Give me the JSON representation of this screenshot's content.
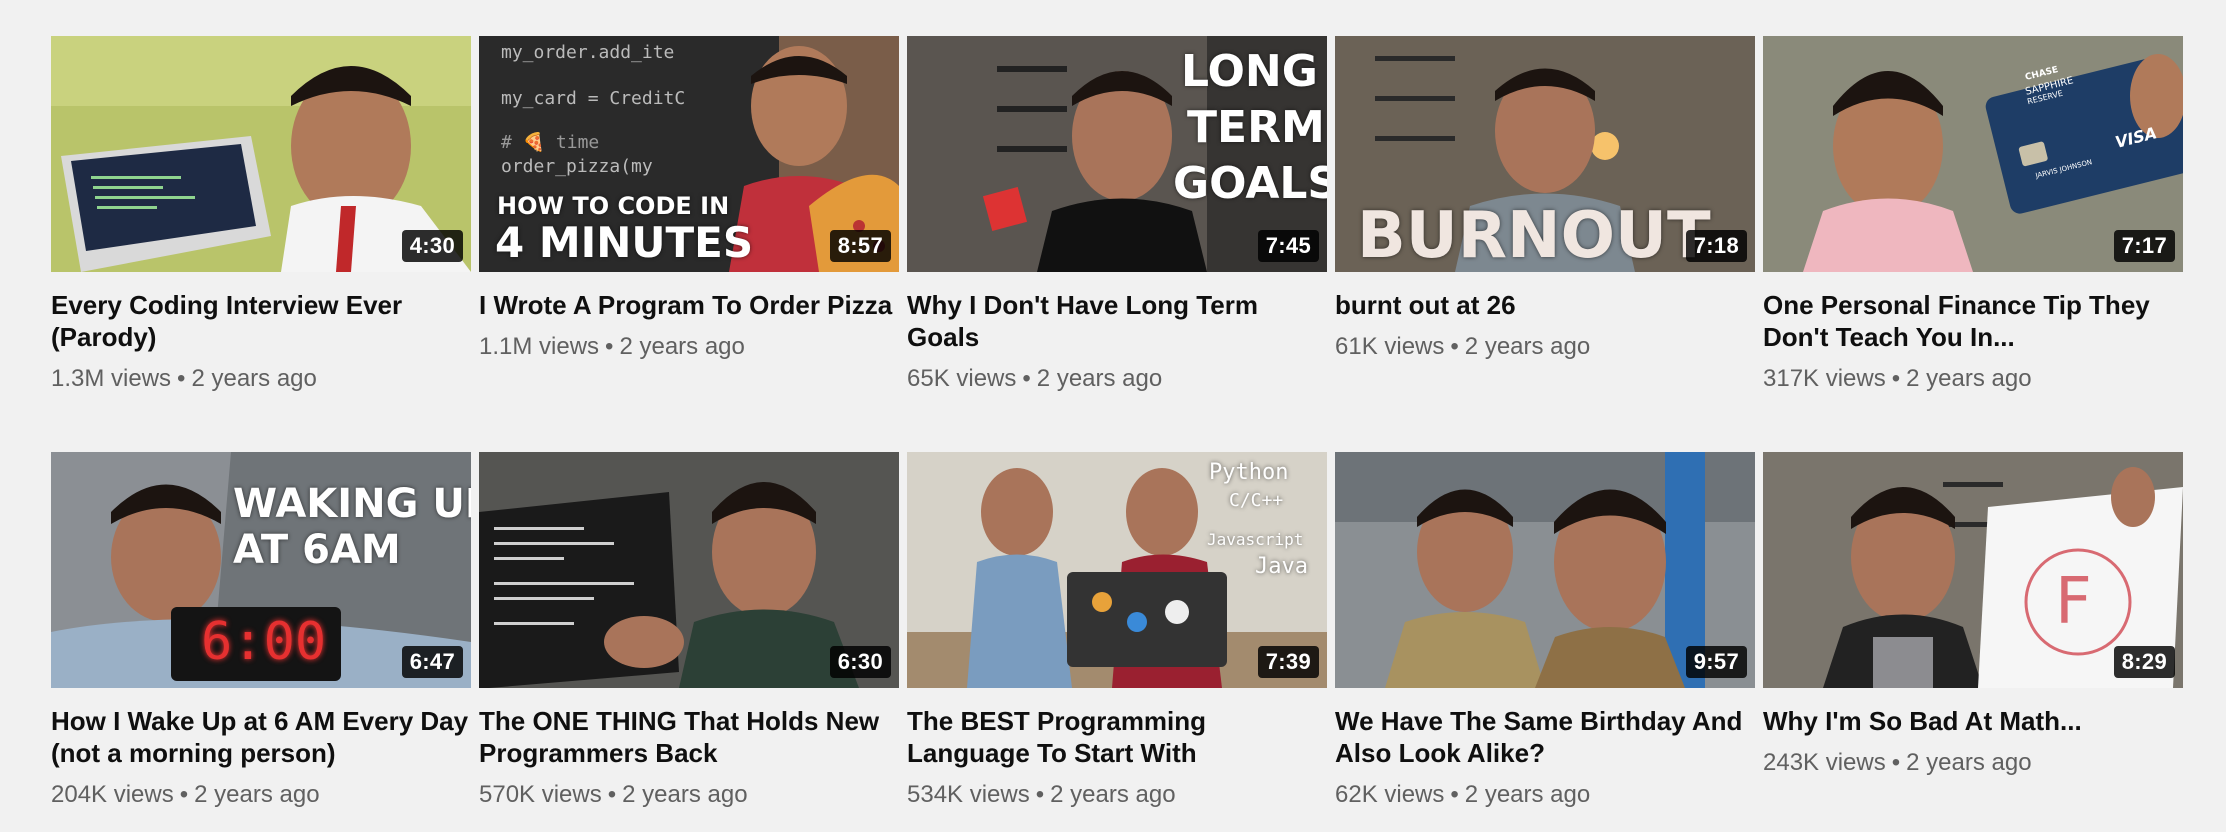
{
  "videos": [
    {
      "title": "Every Coding Interview Ever (Parody)",
      "views": "1.3M views",
      "age": "2 years ago",
      "duration": "4:30",
      "thumb_bg": "#b9c46a",
      "overlay": []
    },
    {
      "title": "I Wrote A Program To Order Pizza",
      "views": "1.1M views",
      "age": "2 years ago",
      "duration": "8:57",
      "thumb_bg": "#2a2a2a",
      "overlay": [
        "my_order.add_ite",
        "my_card = CreditC",
        "# 🍕 time",
        "order_pizza(my",
        "HOW TO CODE IN",
        "4 MINUTES"
      ]
    },
    {
      "title": "Why I Don't Have Long Term Goals",
      "views": "65K views",
      "age": "2 years ago",
      "duration": "7:45",
      "thumb_bg": "#5a5550",
      "overlay": [
        "LONG",
        "TERM",
        "GOALS"
      ]
    },
    {
      "title": "burnt out at 26",
      "views": "61K views",
      "age": "2 years ago",
      "duration": "7:18",
      "thumb_bg": "#6b6256",
      "overlay": [
        "BURNOUT"
      ]
    },
    {
      "title": "One Personal Finance Tip They Don't Teach You In...",
      "views": "317K views",
      "age": "2 years ago",
      "duration": "7:17",
      "thumb_bg": "#8a8a7a",
      "overlay": [
        "CHASE",
        "SAPPHIRE",
        "RESERVE",
        "VISA",
        "JARVIS JOHNSON"
      ]
    },
    {
      "title": "How I Wake Up at 6 AM Every Day (not a morning person)",
      "views": "204K views",
      "age": "2 years ago",
      "duration": "6:47",
      "thumb_bg": "#6f7478",
      "overlay": [
        "WAKING UP",
        "AT 6AM",
        "6:00"
      ]
    },
    {
      "title": "The ONE THING That Holds New Programmers Back",
      "views": "570K views",
      "age": "2 years ago",
      "duration": "6:30",
      "thumb_bg": "#555552",
      "overlay": []
    },
    {
      "title": "The BEST Programming Language To Start With",
      "views": "534K views",
      "age": "2 years ago",
      "duration": "7:39",
      "thumb_bg": "#a38b6e",
      "overlay": [
        "Python",
        "C/C++",
        "Javascript",
        "Java"
      ]
    },
    {
      "title": "We Have The Same Birthday And Also Look Alike?",
      "views": "62K views",
      "age": "2 years ago",
      "duration": "9:57",
      "thumb_bg": "#8a8f93",
      "overlay": []
    },
    {
      "title": "Why I'm So Bad At Math...",
      "views": "243K views",
      "age": "2 years ago",
      "duration": "8:29",
      "thumb_bg": "#7a756c",
      "overlay": [
        "F"
      ]
    }
  ],
  "separator": "•"
}
